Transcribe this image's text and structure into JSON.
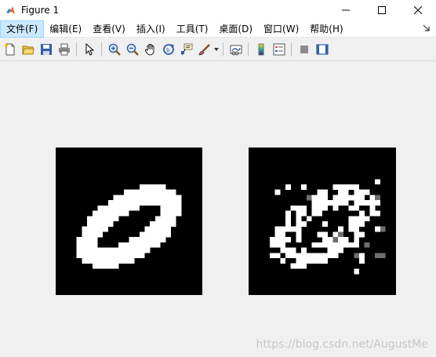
{
  "window": {
    "title": "Figure 1",
    "controls": [
      "minimize",
      "maximize",
      "close"
    ]
  },
  "menubar": {
    "items": [
      "文件(F)",
      "编辑(E)",
      "查看(V)",
      "插入(I)",
      "工具(T)",
      "桌面(D)",
      "窗口(W)",
      "帮助(H)"
    ],
    "active_index": 0
  },
  "toolbar": {
    "icons": [
      "new-figure-icon",
      "open-file-icon",
      "save-icon",
      "print-icon",
      "pointer-icon",
      "zoom-in-icon",
      "zoom-out-icon",
      "pan-hand-icon",
      "rotate-3d-icon",
      "data-cursor-icon",
      "brush-icon",
      "link-plot-icon",
      "colorbar-icon",
      "legend-icon",
      "hide-plot-tools-icon",
      "show-plot-tools-icon"
    ]
  },
  "watermark": "https://blog.csdn.net/AugustMe",
  "colors": {
    "titlebar": "#ffffff",
    "menu_active": "#cce8ff",
    "background": "#f0f0f0",
    "matlab_logo": "#e0621a"
  }
}
